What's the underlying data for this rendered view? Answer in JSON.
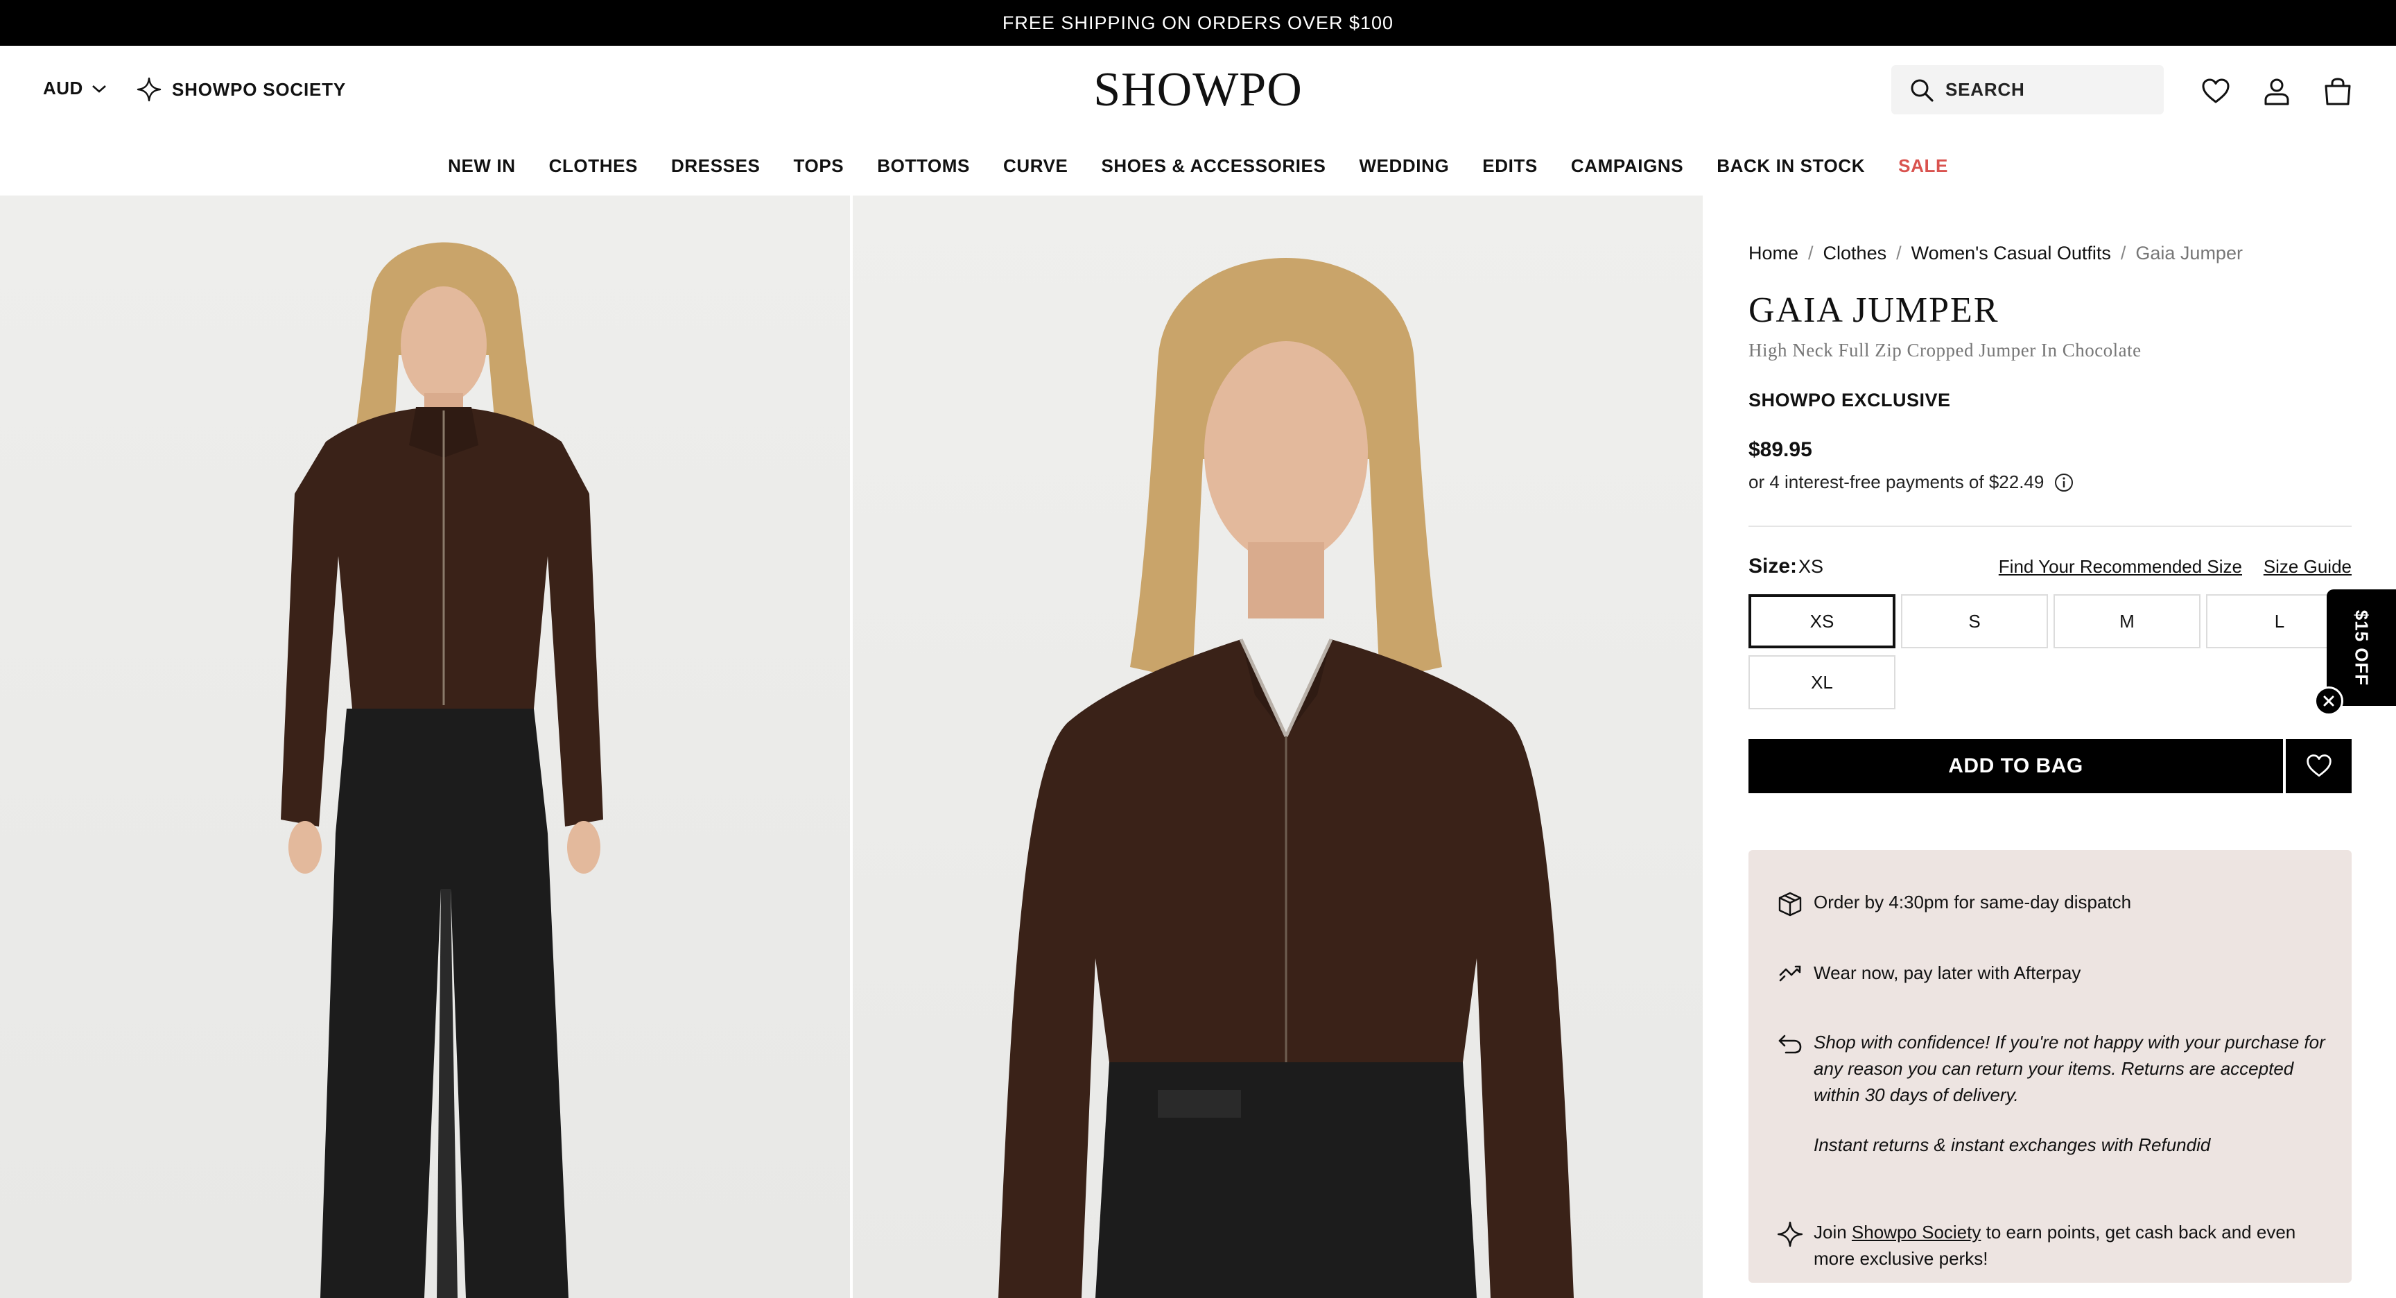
{
  "announcement": "FREE SHIPPING ON ORDERS OVER $100",
  "header": {
    "currency": "AUD",
    "society_label": "SHOWPO SOCIETY",
    "logo": "SHOWPO",
    "search_placeholder": "SEARCH",
    "icons": [
      "search-icon",
      "heart-icon",
      "account-icon",
      "bag-icon"
    ]
  },
  "nav": {
    "items": [
      "NEW IN",
      "CLOTHES",
      "DRESSES",
      "TOPS",
      "BOTTOMS",
      "CURVE",
      "SHOES & ACCESSORIES",
      "WEDDING",
      "EDITS",
      "CAMPAIGNS",
      "BACK IN STOCK",
      "SALE"
    ],
    "sale_color": "#d9534f"
  },
  "breadcrumb": {
    "items": [
      "Home",
      "Clothes",
      "Women's Casual Outfits"
    ],
    "current": "Gaia Jumper",
    "separator": "/"
  },
  "product": {
    "title": "GAIA JUMPER",
    "subtitle": "High Neck Full Zip Cropped Jumper In Chocolate",
    "badge": "SHOWPO EXCLUSIVE",
    "price": "$89.95",
    "installments": "or 4 interest-free payments of $22.49",
    "color_swatch": "#3a2218"
  },
  "size": {
    "label": "Size:",
    "selected": "XS",
    "find_link": "Find Your Recommended Size",
    "guide_link": "Size Guide",
    "options": [
      "XS",
      "S",
      "M",
      "L",
      "XL"
    ]
  },
  "actions": {
    "add_to_bag": "ADD TO BAG"
  },
  "info": {
    "dispatch": "Order by 4:30pm for same-day dispatch",
    "afterpay": "Wear now, pay later with Afterpay",
    "returns": "Shop with confidence! If you're not happy with your purchase for any reason you can return your items. Returns are accepted within 30 days of delivery.",
    "refundid": "Instant returns & instant exchanges with Refundid",
    "society_pre": "Join ",
    "society_link": "Showpo Society",
    "society_post": " to earn points, get cash back and even more exclusive perks!",
    "background": "#ede4e1"
  },
  "promo": {
    "tab_label": "$15 OFF"
  }
}
